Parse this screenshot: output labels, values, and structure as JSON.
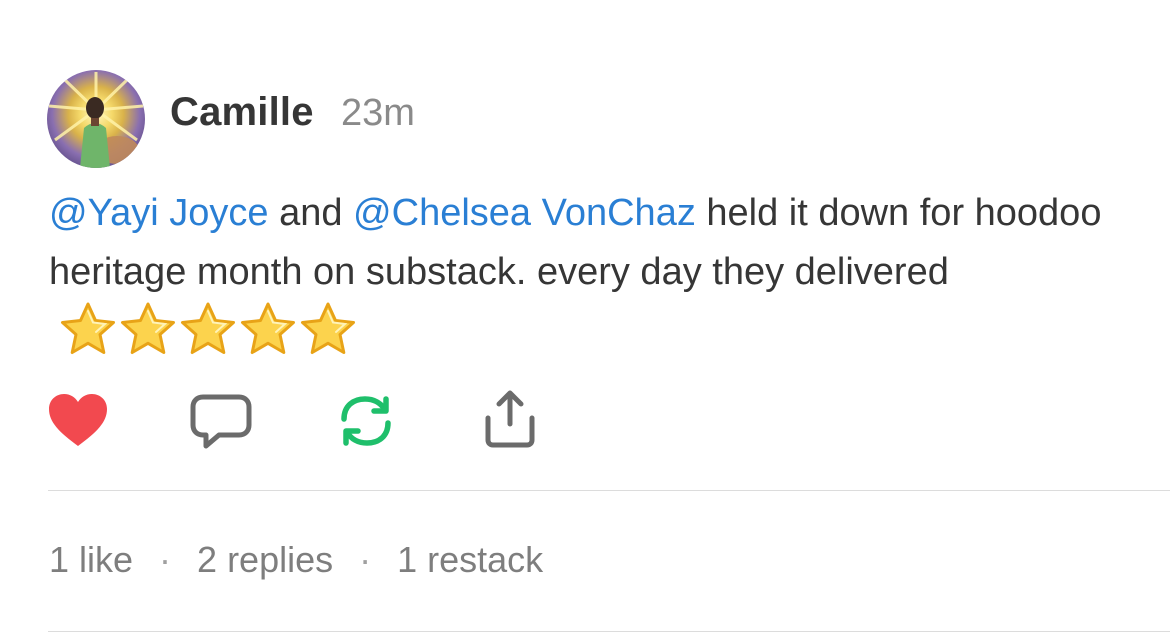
{
  "post": {
    "author": "Camille",
    "time": "23m",
    "mention1": "@Yayi Joyce",
    "text_and": " and ",
    "mention2": "@Chelsea VonChaz",
    "text_rest": " held it down for hoodoo heritage month on substack. every day they delivered",
    "rating_stars": 5
  },
  "actions": {
    "like_icon": "heart-icon",
    "reply_icon": "comment-icon",
    "restack_icon": "restack-icon",
    "share_icon": "share-icon",
    "liked_color": "#f2494f",
    "restack_color": "#1fbf6b"
  },
  "stats": {
    "likes": "1 like",
    "sep1": "·",
    "replies": "2 replies",
    "sep2": "·",
    "restacks": "1 restack"
  }
}
